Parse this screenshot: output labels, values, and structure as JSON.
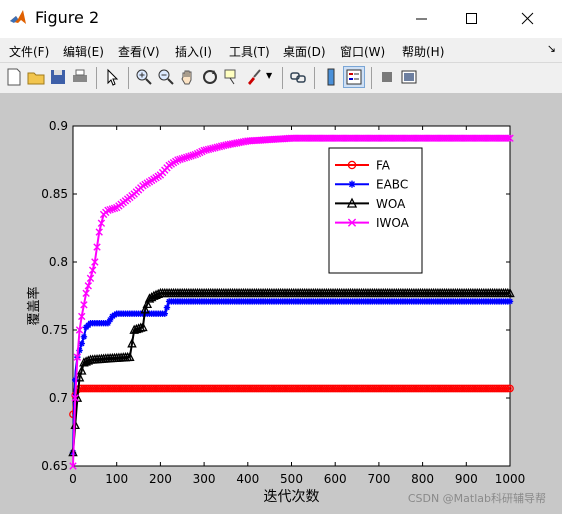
{
  "window": {
    "title": "Figure 2",
    "icon": "matlab-logo-icon",
    "controls": [
      "minimize-icon",
      "maximize-icon",
      "close-icon"
    ]
  },
  "menu": {
    "items": [
      {
        "label": "文件(F)"
      },
      {
        "label": "编辑(E)"
      },
      {
        "label": "查看(V)"
      },
      {
        "label": "插入(I)"
      },
      {
        "label": "工具(T)"
      },
      {
        "label": "桌面(D)"
      },
      {
        "label": "窗口(W)"
      },
      {
        "label": "帮助(H)"
      }
    ],
    "overflow_icon": "dock-arrow-icon"
  },
  "toolbar": {
    "buttons": [
      "new-figure-icon",
      "open-icon",
      "save-icon",
      "print-icon",
      "pointer-icon",
      "zoom-in-icon",
      "zoom-out-icon",
      "pan-icon",
      "rotate-3d-icon",
      "data-cursor-icon",
      "brush-icon",
      "link-icon",
      "colorbar-icon",
      "legend-icon",
      "hide-tools-icon",
      "show-tools-icon"
    ]
  },
  "watermark": "CSDN @Matlab科研辅导帮",
  "chart_data": {
    "type": "line",
    "title": "",
    "xlabel": "迭代次数",
    "ylabel": "覆盖率",
    "xlim": [
      0,
      1000
    ],
    "ylim": [
      0.65,
      0.9
    ],
    "xticks": [
      0,
      100,
      200,
      300,
      400,
      500,
      600,
      700,
      800,
      900,
      1000
    ],
    "yticks": [
      0.65,
      0.7,
      0.75,
      0.8,
      0.85,
      0.9
    ],
    "grid": false,
    "legend": "top-right",
    "series": [
      {
        "name": "FA",
        "color": "#ff0000",
        "marker": "circle",
        "x": [
          0,
          3,
          6,
          10,
          15,
          1000
        ],
        "y": [
          0.688,
          0.7,
          0.703,
          0.706,
          0.707,
          0.707
        ]
      },
      {
        "name": "EABC",
        "color": "#0000ff",
        "marker": "star",
        "x": [
          0,
          3,
          6,
          10,
          15,
          25,
          30,
          40,
          50,
          80,
          90,
          100,
          210,
          220,
          1000
        ],
        "y": [
          0.66,
          0.7,
          0.72,
          0.73,
          0.735,
          0.745,
          0.752,
          0.755,
          0.755,
          0.755,
          0.76,
          0.762,
          0.762,
          0.771,
          0.771
        ]
      },
      {
        "name": "WOA",
        "color": "#000000",
        "marker": "triangle",
        "x": [
          0,
          5,
          10,
          15,
          20,
          25,
          40,
          80,
          130,
          135,
          140,
          160,
          165,
          175,
          185,
          200,
          300,
          1000
        ],
        "y": [
          0.66,
          0.68,
          0.7,
          0.715,
          0.72,
          0.726,
          0.728,
          0.729,
          0.73,
          0.74,
          0.75,
          0.752,
          0.765,
          0.773,
          0.775,
          0.777,
          0.777,
          0.777
        ]
      },
      {
        "name": "IWOA",
        "color": "#ff00ff",
        "marker": "x",
        "x": [
          0,
          5,
          10,
          15,
          20,
          30,
          40,
          50,
          60,
          70,
          80,
          100,
          120,
          140,
          160,
          180,
          200,
          220,
          240,
          260,
          280,
          300,
          350,
          400,
          450,
          500,
          600,
          700,
          800,
          900,
          1000
        ],
        "y": [
          0.65,
          0.7,
          0.73,
          0.75,
          0.76,
          0.777,
          0.788,
          0.8,
          0.822,
          0.835,
          0.838,
          0.84,
          0.845,
          0.85,
          0.856,
          0.86,
          0.864,
          0.871,
          0.875,
          0.877,
          0.879,
          0.882,
          0.886,
          0.889,
          0.89,
          0.891,
          0.891,
          0.891,
          0.891,
          0.891,
          0.891
        ]
      }
    ]
  }
}
